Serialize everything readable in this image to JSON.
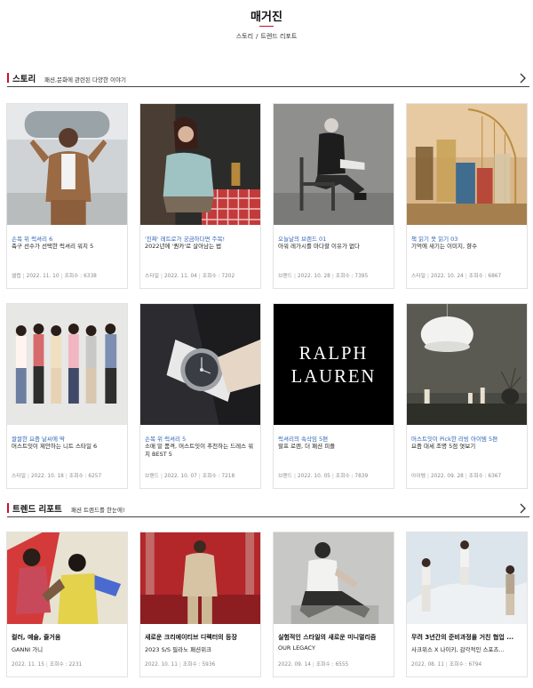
{
  "header": {
    "title": "매거진",
    "breadcrumb": [
      "스토리",
      "트렌드 리포트"
    ],
    "accent_color": "#c8102e"
  },
  "story_section": {
    "name": "스토리",
    "description": "패션,문화에 관련된 다양한 이야기",
    "more_icon": "chevron-right-icon",
    "cards": [
      {
        "category": "손목 위 럭셔리 6",
        "title": "축구 선수가 선택한 럭셔리 워치 5",
        "type": "셀럽",
        "date": "2022. 11. 10",
        "views": "조회수 : 6338"
      },
      {
        "category": "'진짜' 레트로가 궁금하다면 주목!",
        "title": "2022년에 '퀀카'로 살아남는 법",
        "type": "스타일",
        "date": "2022. 11. 04",
        "views": "조회수 : 7202"
      },
      {
        "category": "오늘날의 브랜드 01",
        "title": "아워 레가시를 마다할 이유가 없다",
        "type": "브랜드",
        "date": "2022. 10. 28",
        "views": "조회수 : 7395"
      },
      {
        "category": "책 읽기 못 읽기 03",
        "title": "기억에 새기는 이미지, 향수",
        "type": "스타일",
        "date": "2022. 10. 24",
        "views": "조회수 : 6867"
      },
      {
        "category": "쌀쌀한 요즘 날씨에 딱",
        "title": "머스트잇이 제안하는 니트 스타일 6",
        "type": "스타일",
        "date": "2022. 10. 18",
        "views": "조회수 : 6257"
      },
      {
        "category": "손목 위 럭셔리 5",
        "title": "소매 밑 품격, 머스트잇이 추천하는 드레스 워치 BEST 5",
        "type": "브랜드",
        "date": "2022. 10. 07",
        "views": "조회수 : 7218"
      },
      {
        "category": "럭셔리의 속삭임 5편",
        "title": "랄프 로렌, 더 패션 피플",
        "type": "브랜드",
        "date": "2022. 10. 05",
        "views": "조회수 : 7839"
      },
      {
        "category": "머스트잇이 Pick한 리빙 아이템 5편",
        "title": "요즘 대세 조명 5점 엿보기",
        "type": "아이템",
        "date": "2022. 09. 28",
        "views": "조회수 : 6367"
      }
    ],
    "logo_text": [
      "RALPH",
      "LAUREN"
    ]
  },
  "trend_section": {
    "name": "트렌드 리포트",
    "description": "패션 트렌드를 한눈에!",
    "more_icon": "chevron-right-icon",
    "cards": [
      {
        "title": "컬러, 예술, 즐거움",
        "subtitle": "GANNI 가니",
        "date": "2022. 11. 15",
        "views": "조회수 : 2231"
      },
      {
        "title": "새로운 크리에이티브 디렉터의 등장",
        "subtitle": "2023 S/S 필라노 패션위크",
        "date": "2022. 10. 11",
        "views": "조회수 : 5936"
      },
      {
        "title": "실험적인 스타일의 새로운 미니멀리즘",
        "subtitle": "OUR LEGACY",
        "date": "2022. 09. 14",
        "views": "조회수 : 6555"
      },
      {
        "title": "무려 3년간의 준비과정을 거친 협업 ...",
        "subtitle": "사크위스 X 나이키, 감각적인 스포츠...",
        "date": "2022. 08. 11",
        "views": "조회수 : 6794"
      }
    ]
  }
}
